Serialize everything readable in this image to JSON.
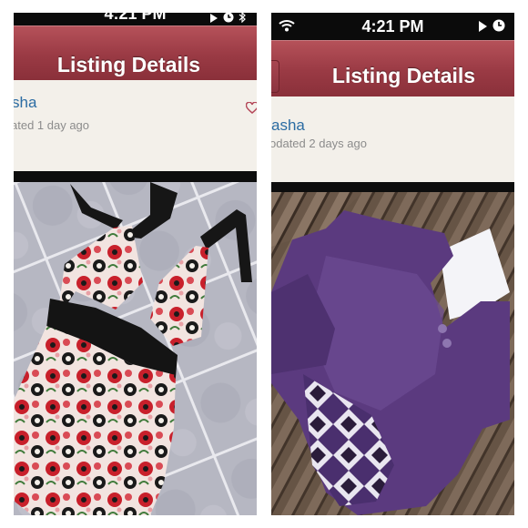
{
  "left": {
    "status": {
      "time": "4:21 PM"
    },
    "header": {
      "title": "Listing Details"
    },
    "listing": {
      "seller": "sha",
      "updated": "ated 1 day ago"
    },
    "photo": {
      "icon": "halter-top-photo"
    },
    "colors": {
      "accent": "#9a3a44",
      "link": "#2b6ca3"
    }
  },
  "right": {
    "status": {
      "time": "4:21 PM"
    },
    "header": {
      "title": "Listing Details"
    },
    "listing": {
      "seller": "asha",
      "updated": "odated 2 days ago"
    },
    "photo": {
      "icon": "purple-cardigan-photo"
    }
  }
}
